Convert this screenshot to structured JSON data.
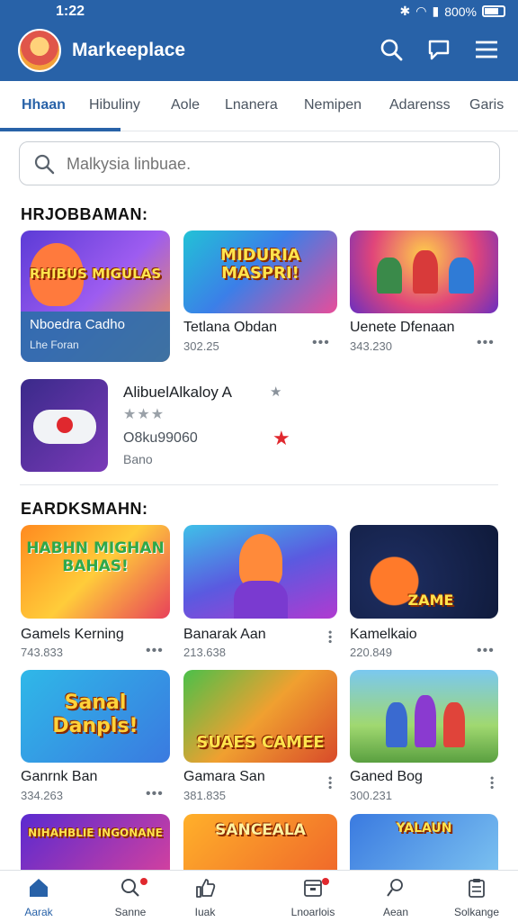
{
  "status_bar": {
    "time": "1:22",
    "battery": "800%"
  },
  "header": {
    "title": "Markeeplace",
    "icons": [
      "search-icon",
      "chat-icon",
      "menu-icon"
    ]
  },
  "tabs": [
    "Hhaan",
    "Hibuliny",
    "Aole",
    "Lnanera",
    "Nemipen",
    "Adarenss",
    "Garis"
  ],
  "search": {
    "placeholder": "Malkysia linbuae."
  },
  "sections": {
    "featured_title": "HRJOBBAMAN:",
    "games_title": "EARDKSMAHN:"
  },
  "featured": [
    {
      "name": "Nboedra Cadho",
      "sub": "Lhe Foran",
      "art_text": "RHIBUS MIGULAS"
    },
    {
      "name": "Tetlana Obdan",
      "sub": "302.25",
      "art_text": "MIDURIA MASPRI!"
    },
    {
      "name": "Uenete Dfenaan",
      "sub": "343.230",
      "art_text": ""
    }
  ],
  "list_item": {
    "name": "AlibuelAlkaloy A",
    "rating_stars": 3,
    "code": "O8ku99060",
    "sub": "Bano"
  },
  "games": [
    {
      "name": "Gamels Kerning",
      "sub": "743.833",
      "art_text": "HABHN MIGHAN BAHAS!"
    },
    {
      "name": "Banarak Aan",
      "sub": "213.638",
      "art_text": ""
    },
    {
      "name": "Kamelkaio",
      "sub": "220.849",
      "art_text": "ZAME"
    },
    {
      "name": "Ganrnk Ban",
      "sub": "334.263",
      "art_text": "Sanal Danpls!"
    },
    {
      "name": "Gamara San",
      "sub": "381.835",
      "art_text": "SUAES CAMEE"
    },
    {
      "name": "Ganed Bog",
      "sub": "300.231",
      "art_text": ""
    },
    {
      "name": "",
      "sub": "",
      "art_text": "NIHAHBLIE INGONANE"
    },
    {
      "name": "",
      "sub": "",
      "art_text": "SANCEALA"
    },
    {
      "name": "",
      "sub": "",
      "art_text": "YALAUN"
    }
  ],
  "bottom_nav": [
    {
      "label": "Aarak",
      "icon": "home-icon",
      "active": true
    },
    {
      "label": "Sanne",
      "icon": "search-icon",
      "dot": true
    },
    {
      "label": "Iuak",
      "icon": "thumbs-up-icon"
    },
    {
      "label": "Lnoarlois",
      "icon": "box-icon",
      "dot": true
    },
    {
      "label": "Aean",
      "icon": "pin-icon"
    },
    {
      "label": "Solkange",
      "icon": "clipboard-icon"
    }
  ],
  "colors": {
    "brand": "#2862a8",
    "star_red": "#e0282e",
    "text": "#1b1f24"
  }
}
